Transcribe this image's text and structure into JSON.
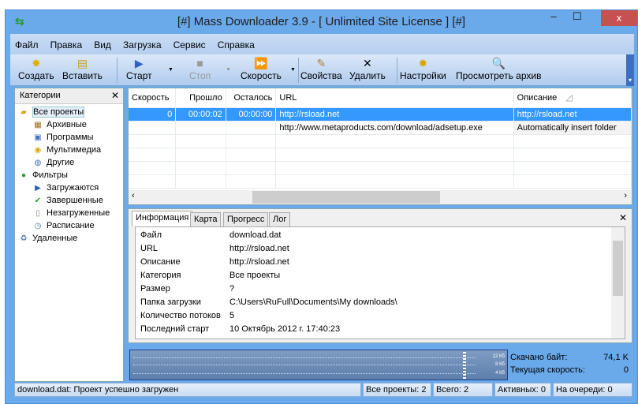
{
  "window": {
    "title": "[#] Mass Downloader 3.9   - [ Unlimited Site License ] [#]",
    "minimize": "–",
    "maximize": "☐",
    "close": "x"
  },
  "menu": [
    "Файл",
    "Правка",
    "Вид",
    "Загрузка",
    "Сервис",
    "Справка"
  ],
  "toolbar": {
    "create": "Создать",
    "paste": "Вставить",
    "start": "Старт",
    "stop": "Стоп",
    "speed": "Скорость",
    "properties": "Свойства",
    "delete": "Удалить",
    "settings": "Настройки",
    "archive": "Просмотреть архив"
  },
  "categories": {
    "title": "Категории",
    "items": [
      "Все проекты",
      "Архивные",
      "Программы",
      "Мультимедиа",
      "Другие",
      "Фильтры",
      "Загружаются",
      "Завершенные",
      "Незагруженные",
      "Расписание",
      "Удаленные"
    ]
  },
  "grid": {
    "columns": [
      "Скорость",
      "Прошло",
      "Осталось",
      "URL",
      "Описание"
    ],
    "rows": [
      {
        "speed": "0",
        "elapsed": "00:00:02",
        "remaining": "00:00:00",
        "url": "http://rsload.net",
        "desc": "http://rsload.net",
        "selected": true
      },
      {
        "speed": "",
        "elapsed": "",
        "remaining": "",
        "url": "http://www.metaproducts.com/download/adsetup.exe",
        "desc": "Automatically insert  folder"
      }
    ]
  },
  "info": {
    "tabs": [
      "Информация",
      "Карта",
      "Прогресс",
      "Лог"
    ],
    "fields": [
      {
        "k": "Файл",
        "v": "download.dat"
      },
      {
        "k": "URL",
        "v": "http://rsload.net"
      },
      {
        "k": "Описание",
        "v": "http://rsload.net"
      },
      {
        "k": "Категория",
        "v": "Все проекты"
      },
      {
        "k": "Размер",
        "v": "?"
      },
      {
        "k": "Папка загрузки",
        "v": "C:\\Users\\RuFull\\Documents\\My downloads\\"
      },
      {
        "k": "Количество потоков",
        "v": "5"
      },
      {
        "k": "Последний старт",
        "v": "10 Октябрь 2012 г. 17:40:23"
      }
    ]
  },
  "graph": {
    "labels": [
      "12 Кб",
      "8 Кб",
      "4 Кб"
    ]
  },
  "stats": {
    "downloaded_label": "Скачано байт:",
    "downloaded": "74,1 K",
    "speed_label": "Текущая скорость:",
    "speed": "0"
  },
  "status": {
    "message": "download.dat: Проект успешно загружен",
    "all": "Все проекты: 2",
    "total": "Всего: 2",
    "active": "Активных: 0",
    "queue": "На очереди: 0"
  }
}
